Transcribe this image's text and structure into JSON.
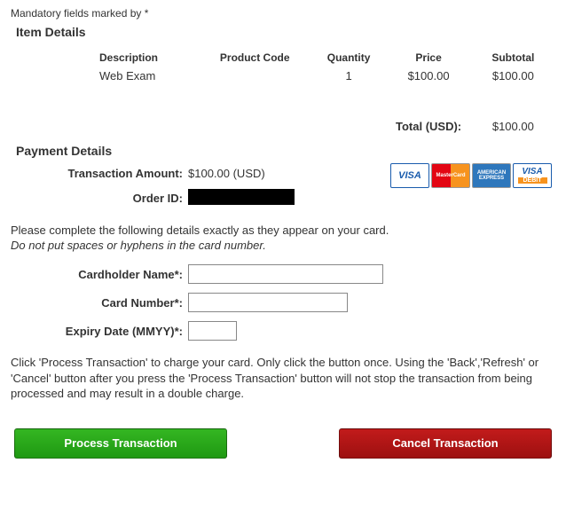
{
  "mandatory_note": "Mandatory fields marked by *",
  "item_details": {
    "title": "Item Details",
    "headers": {
      "description": "Description",
      "product_code": "Product Code",
      "quantity": "Quantity",
      "price": "Price",
      "subtotal": "Subtotal"
    },
    "row": {
      "description": "Web Exam",
      "product_code": "",
      "quantity": "1",
      "price": "$100.00",
      "subtotal": "$100.00"
    },
    "total_label": "Total (USD):",
    "total_value": "$100.00"
  },
  "payment_details": {
    "title": "Payment Details",
    "transaction_amount_label": "Transaction Amount:",
    "transaction_amount_value": "$100.00 (USD)",
    "order_id_label": "Order ID:",
    "instructions_line1": "Please complete the following details exactly as they appear on your card.",
    "instructions_line2": "Do not put spaces or hyphens in the card number.",
    "cardholder_label": "Cardholder Name*:",
    "cardnumber_label": "Card Number*:",
    "expiry_label": "Expiry Date (MMYY)*:",
    "disclaimer": "Click 'Process Transaction' to charge your card. Only click the button once. Using the 'Back','Refresh' or 'Cancel' button after you press the 'Process Transaction' button will not stop the transaction from being processed and may result in a double charge."
  },
  "card_logos": {
    "visa": "VISA",
    "mc": "MasterCard",
    "amex": "AMERICAN EXPRESS",
    "visa_debit_top": "VISA",
    "visa_debit_sub": "DEBIT"
  },
  "buttons": {
    "process": "Process Transaction",
    "cancel": "Cancel Transaction"
  }
}
